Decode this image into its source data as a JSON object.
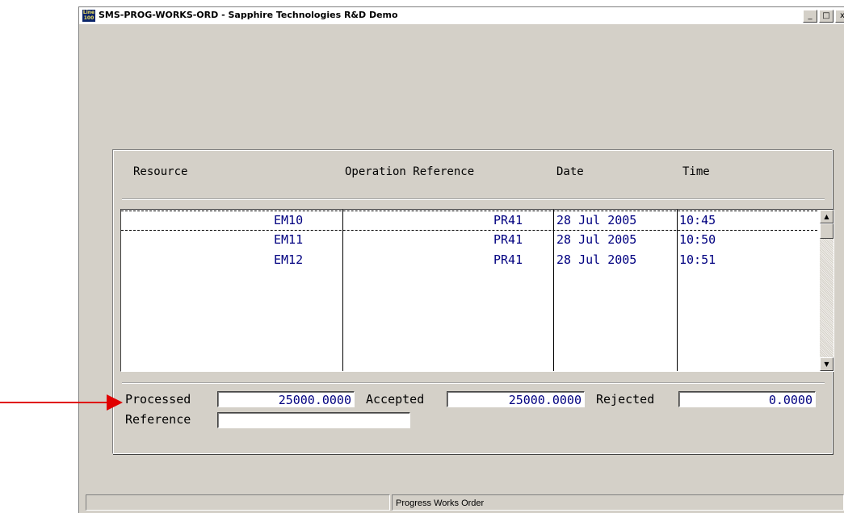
{
  "window": {
    "title": "SMS-PROG-WORKS-ORD - Sapphire Technologies R&D Demo",
    "icon_text": "Line 100",
    "controls": [
      "_",
      "□",
      "x"
    ]
  },
  "list": {
    "headers": {
      "resource": "Resource",
      "operation_reference": "Operation Reference",
      "date": "Date",
      "time": "Time"
    },
    "rows": [
      {
        "resource": "EM10",
        "operation_reference": "PR41",
        "date": "28 Jul 2005",
        "time": "10:45"
      },
      {
        "resource": "EM11",
        "operation_reference": "PR41",
        "date": "28 Jul 2005",
        "time": "10:50"
      },
      {
        "resource": "EM12",
        "operation_reference": "PR41",
        "date": "28 Jul 2005",
        "time": "10:51"
      }
    ],
    "selected_row": 0
  },
  "form": {
    "processed_label": "Processed",
    "processed_value": "25000.0000",
    "accepted_label": "Accepted",
    "accepted_value": "25000.0000",
    "rejected_label": "Rejected",
    "rejected_value": "0.0000",
    "reference_label": "Reference",
    "reference_value": ""
  },
  "statusbar": {
    "left": "",
    "center": "Progress Works Order"
  },
  "annotation": {
    "arrow_color": "#e00000",
    "icon": "arrow-right-icon"
  },
  "colors": {
    "window_bg": "#d4d0c8",
    "value_text": "#000080"
  }
}
